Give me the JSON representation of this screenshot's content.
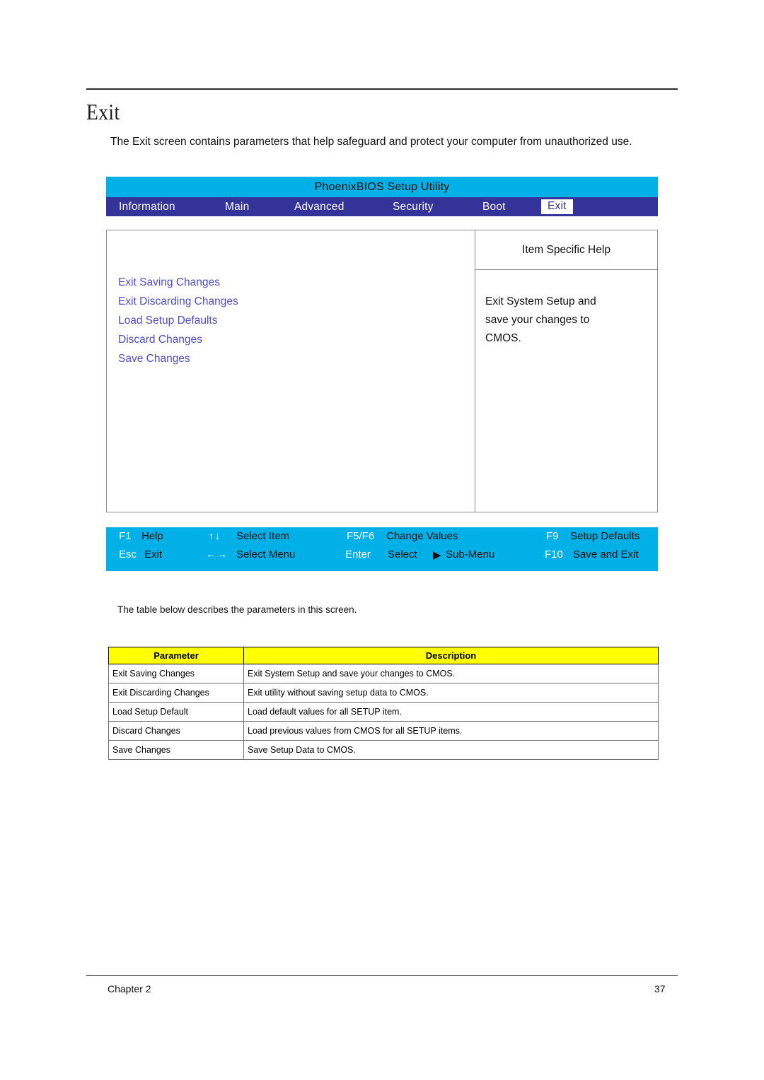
{
  "document": {
    "heading": "Exit",
    "intro": "The Exit screen contains parameters that help safeguard and protect your computer from unauthorized use.",
    "table_lead": "The table below describes the parameters in this screen.",
    "footer": {
      "chapter": "Chapter 2",
      "page_number": "37"
    }
  },
  "bios": {
    "title": "PhoenixBIOS Setup Utility",
    "tabs": [
      {
        "label": "Information",
        "selected": false
      },
      {
        "label": "Main",
        "selected": false
      },
      {
        "label": "Advanced",
        "selected": false
      },
      {
        "label": "Security",
        "selected": false
      },
      {
        "label": "Boot",
        "selected": false
      },
      {
        "label": "Exit",
        "selected": true
      }
    ],
    "menu_items": [
      "Exit Saving Changes",
      "Exit Discarding Changes",
      "Load Setup Defaults",
      "Discard Changes",
      "Save Changes"
    ],
    "help": {
      "header": "Item Specific Help",
      "line1": "Exit System Setup and",
      "line2": "save your changes to",
      "line3": "CMOS."
    },
    "keybar": [
      {
        "key": "F1",
        "arrow": "",
        "action": "Help"
      },
      {
        "key": "Esc",
        "arrow": "",
        "action": "Exit"
      },
      {
        "key": "",
        "arrow": "↑↓",
        "action": "Select Item"
      },
      {
        "key": "",
        "arrow": "←→",
        "action": "Select Menu"
      },
      {
        "key": "F5/F6",
        "arrow": "",
        "action": "Change Values"
      },
      {
        "key": "Enter",
        "arrow": "",
        "action": "Select"
      },
      {
        "key": "",
        "arrow": "▶",
        "action": "Sub-Menu"
      },
      {
        "key": "F9",
        "arrow": "",
        "action": "Setup Defaults"
      },
      {
        "key": "F10",
        "arrow": "",
        "action": "Save and Exit"
      }
    ],
    "colors": {
      "title_bar": "#00b0e6",
      "tab_bar": "#333399",
      "menu_text": "#4d4dc6",
      "selected_tab_bg": "#ffffff",
      "keybar": "#00b0e6",
      "table_header": "#ffff00"
    }
  },
  "param_table": {
    "headers": [
      "Parameter",
      "Description"
    ],
    "rows": [
      [
        "Exit Saving Changes",
        "Exit System Setup and save your changes to CMOS."
      ],
      [
        "Exit Discarding Changes",
        "Exit utility without saving setup data to CMOS."
      ],
      [
        "Load Setup Default",
        "Load default values for all SETUP item."
      ],
      [
        "Discard Changes",
        "Load previous values from CMOS for all SETUP items."
      ],
      [
        "Save Changes",
        "Save Setup Data to CMOS."
      ]
    ]
  }
}
